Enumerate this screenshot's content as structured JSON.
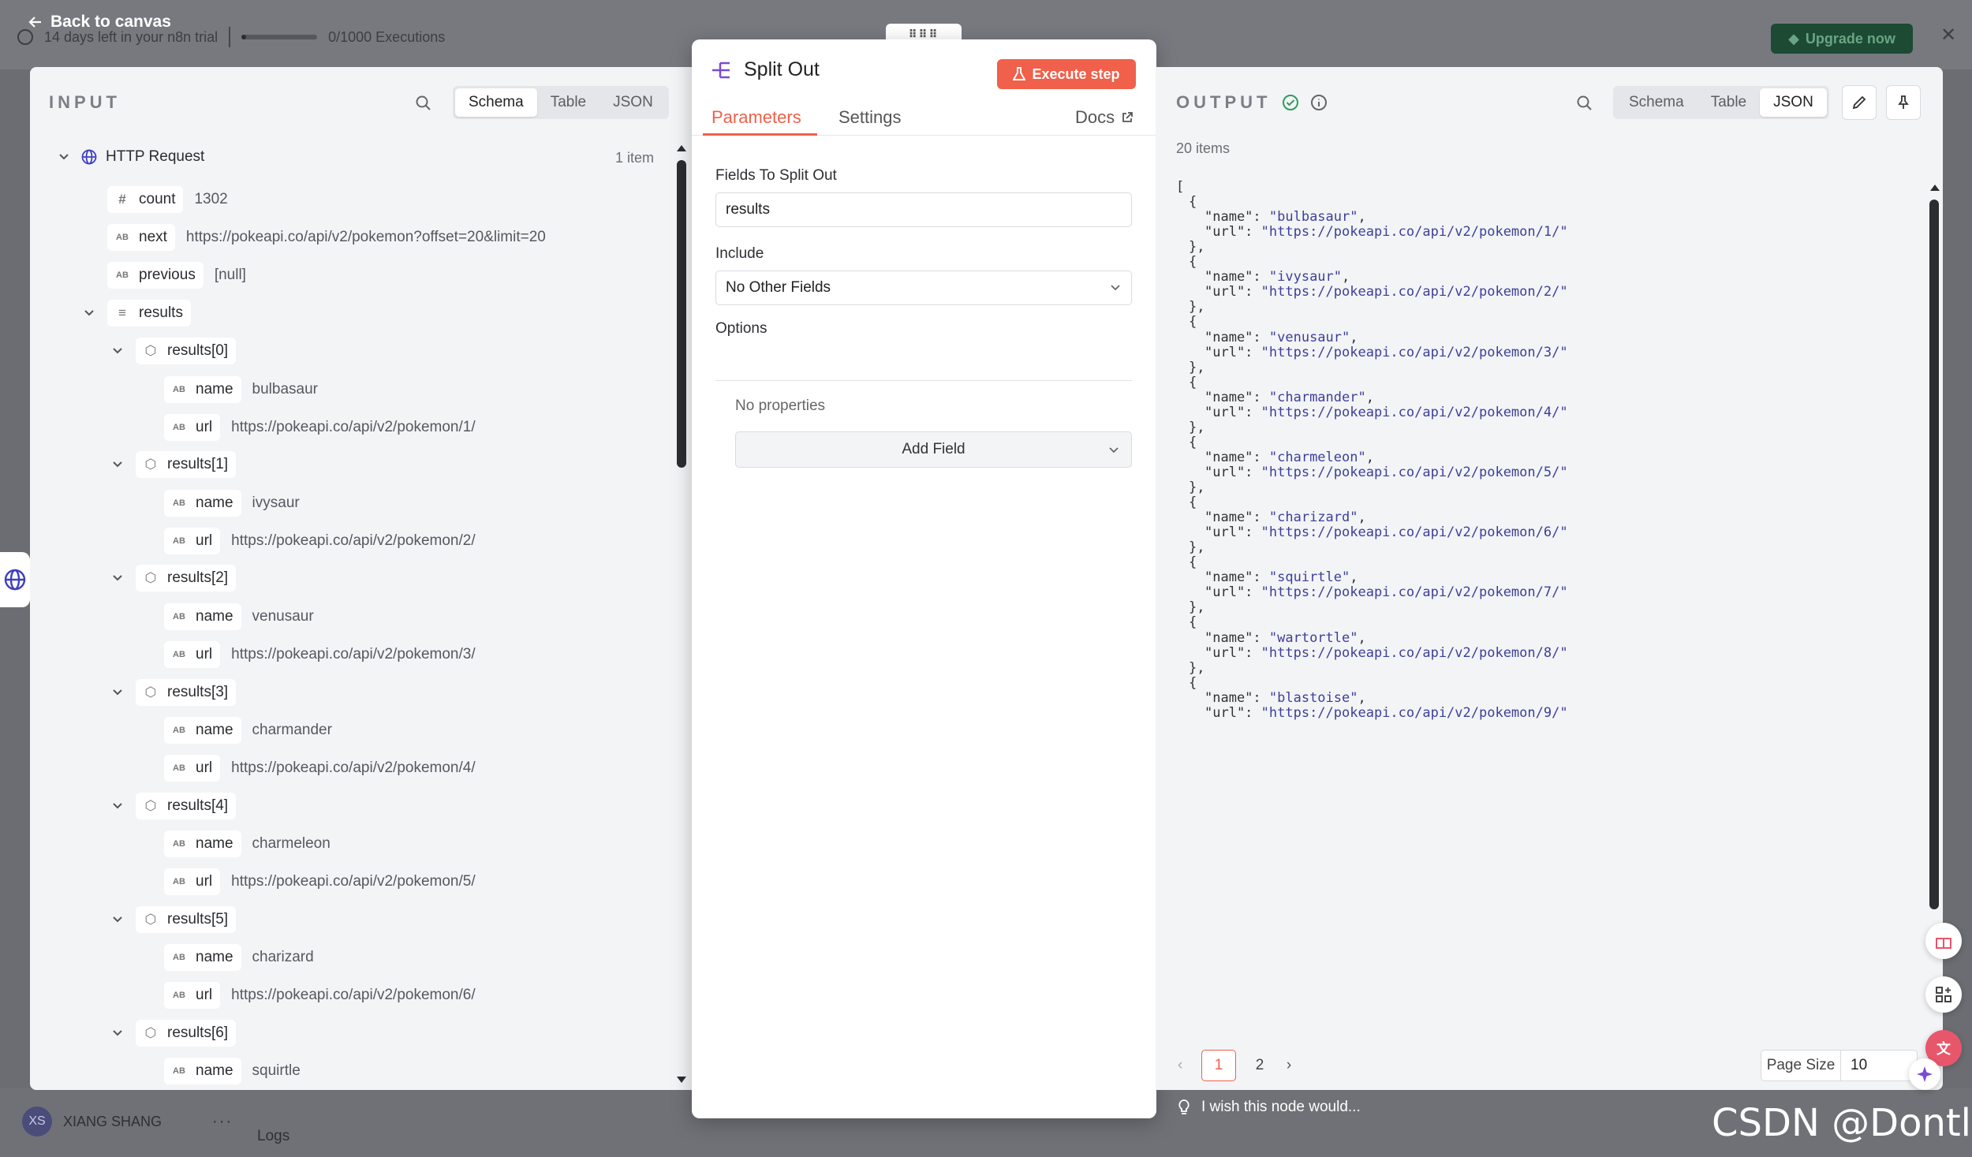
{
  "background": {
    "trial_text": "14 days left in your n8n trial",
    "executions_text": "0/1000 Executions",
    "upgrade_label": "Upgrade now",
    "back_label": "Back to canvas",
    "user_initials": "XS",
    "user_name": "XIANG SHANG",
    "logs_label": "Logs"
  },
  "input": {
    "title": "INPUT",
    "views": [
      "Schema",
      "Table",
      "JSON"
    ],
    "active_view": "Schema",
    "node_name": "HTTP Request",
    "item_count": "1 item",
    "fields": {
      "count": {
        "key": "count",
        "value": "1302"
      },
      "next": {
        "key": "next",
        "value": "https://pokeapi.co/api/v2/pokemon?offset=20&limit=20"
      },
      "previous": {
        "key": "previous",
        "value": "[null]"
      },
      "results": {
        "key": "results"
      }
    },
    "results": [
      {
        "label": "results[0]",
        "name": "bulbasaur",
        "url": "https://pokeapi.co/api/v2/pokemon/1/"
      },
      {
        "label": "results[1]",
        "name": "ivysaur",
        "url": "https://pokeapi.co/api/v2/pokemon/2/"
      },
      {
        "label": "results[2]",
        "name": "venusaur",
        "url": "https://pokeapi.co/api/v2/pokemon/3/"
      },
      {
        "label": "results[3]",
        "name": "charmander",
        "url": "https://pokeapi.co/api/v2/pokemon/4/"
      },
      {
        "label": "results[4]",
        "name": "charmeleon",
        "url": "https://pokeapi.co/api/v2/pokemon/5/"
      },
      {
        "label": "results[5]",
        "name": "charizard",
        "url": "https://pokeapi.co/api/v2/pokemon/6/"
      },
      {
        "label": "results[6]",
        "name": "squirtle"
      }
    ],
    "key_labels": {
      "name": "name",
      "url": "url"
    },
    "type_string": "AB",
    "type_number": "#"
  },
  "node": {
    "title": "Split Out",
    "execute_label": "Execute step",
    "tabs": [
      "Parameters",
      "Settings"
    ],
    "docs_label": "Docs",
    "fields_label": "Fields To Split Out",
    "fields_value": "results",
    "include_label": "Include",
    "include_value": "No Other Fields",
    "options_label": "Options",
    "no_properties": "No properties",
    "add_field_label": "Add Field",
    "wish_text": "I wish this node would..."
  },
  "output": {
    "title": "OUTPUT",
    "views": [
      "Schema",
      "Table",
      "JSON"
    ],
    "active_view": "JSON",
    "items_count": "20 items",
    "items": [
      {
        "name": "bulbasaur",
        "url": "https://pokeapi.co/api/v2/pokemon/1/"
      },
      {
        "name": "ivysaur",
        "url": "https://pokeapi.co/api/v2/pokemon/2/"
      },
      {
        "name": "venusaur",
        "url": "https://pokeapi.co/api/v2/pokemon/3/"
      },
      {
        "name": "charmander",
        "url": "https://pokeapi.co/api/v2/pokemon/4/"
      },
      {
        "name": "charmeleon",
        "url": "https://pokeapi.co/api/v2/pokemon/5/"
      },
      {
        "name": "charizard",
        "url": "https://pokeapi.co/api/v2/pokemon/6/"
      },
      {
        "name": "squirtle",
        "url": "https://pokeapi.co/api/v2/pokemon/7/"
      },
      {
        "name": "wartortle",
        "url": "https://pokeapi.co/api/v2/pokemon/8/"
      },
      {
        "name": "blastoise",
        "url": "https://pokeapi.co/api/v2/pokemon/9/"
      }
    ],
    "pages": [
      "1",
      "2"
    ],
    "current_page": "1",
    "page_size_label": "Page Size",
    "page_size_value": "10"
  },
  "watermark": "CSDN @Dontla",
  "colors": {
    "accent": "#f0604a",
    "success": "#2f9d5c",
    "json_string": "#3d3f9a",
    "upgrade_bg": "#1c4a33"
  }
}
